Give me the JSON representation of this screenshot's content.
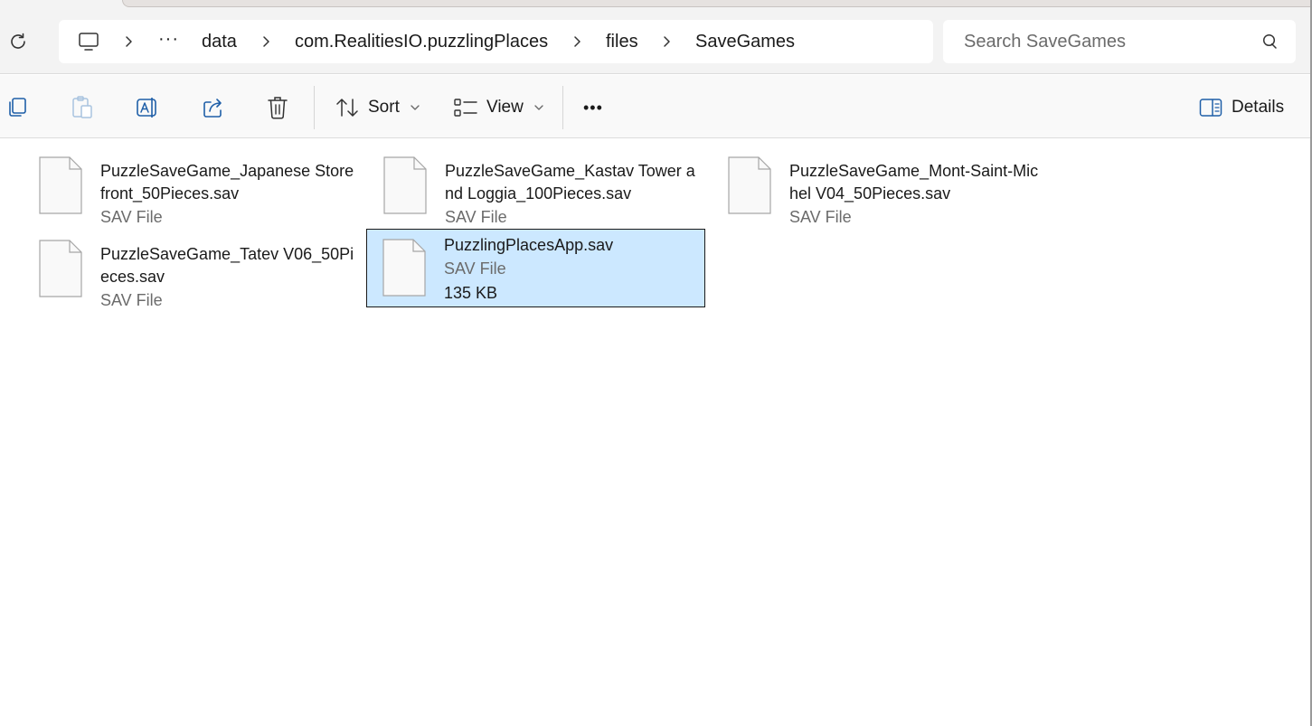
{
  "breadcrumb": {
    "overflow": "···",
    "items": [
      "data",
      "com.RealitiesIO.puzzlingPlaces",
      "files",
      "SaveGames"
    ]
  },
  "search": {
    "placeholder": "Search SaveGames"
  },
  "toolbar": {
    "sort_label": "Sort",
    "view_label": "View",
    "more_label": "•••",
    "details_label": "Details"
  },
  "files": [
    {
      "name": "PuzzleSaveGame_Japanese Storefront_50Pieces.sav",
      "type": "SAV File"
    },
    {
      "name": "PuzzleSaveGame_Kastav Tower and Loggia_100Pieces.sav",
      "type": "SAV File"
    },
    {
      "name": "PuzzleSaveGame_Mont-Saint-Michel V04_50Pieces.sav",
      "type": "SAV File"
    },
    {
      "name": "PuzzleSaveGame_Tatev V06_50Pieces.sav",
      "type": "SAV File"
    },
    {
      "name": "PuzzlingPlacesApp.sav",
      "type": "SAV File",
      "size": "135 KB",
      "selected": true
    }
  ],
  "colors": {
    "selection_fill": "#cce8ff",
    "chrome_bg": "#f3f3f3",
    "text_secondary": "#6b6b6b"
  }
}
